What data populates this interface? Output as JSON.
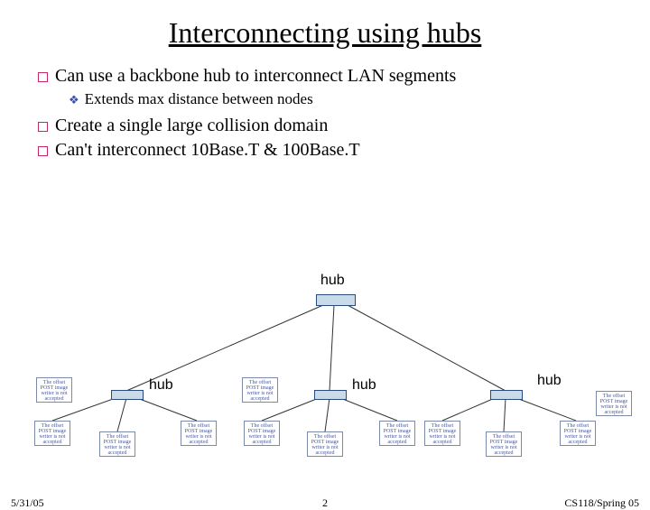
{
  "title": "Interconnecting using hubs",
  "bullets": {
    "b1": "Can use a backbone hub to interconnect LAN segments",
    "b1_sub": "Extends max distance between nodes",
    "b2": "Create a single large collision domain",
    "b3": "Can't interconnect 10Base.T & 100Base.T"
  },
  "labels": {
    "hub": "hub"
  },
  "placeholder_text": "The offset POST image writer is not accepted",
  "footer": {
    "date": "5/31/05",
    "page": "2",
    "course": "CS118/Spring 05"
  }
}
